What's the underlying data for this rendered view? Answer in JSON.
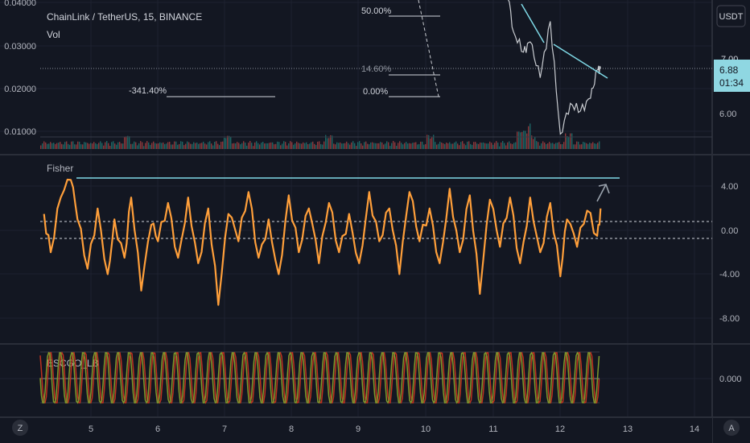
{
  "symbol": {
    "title": "ChainLink / TetherUS, 15, BINANCE",
    "volume_label": "Vol"
  },
  "currency_button": "USDT",
  "price_panel": {
    "left_axis_ticks": [
      "0.04000",
      "0.03000",
      "0.02000",
      "0.01000"
    ],
    "right_axis_ticks": [
      "6.00"
    ],
    "partial_tick": "7.00",
    "last_price": "6.88",
    "countdown": "01:34",
    "fib_levels": [
      {
        "label": "50.00%"
      },
      {
        "label": "14.60%"
      },
      {
        "label": "0.00%"
      },
      {
        "label": "-341.40%"
      }
    ]
  },
  "fisher_panel": {
    "label": "Fisher",
    "right_axis_ticks": [
      "4.00",
      "0.00",
      "-4.00",
      "-8.00"
    ],
    "colors": {
      "line": "#ff9f3a",
      "trend": "#7fd9e6",
      "arrow": "#9aa3ad"
    }
  },
  "escgo_panel": {
    "label": "ESCGO_LB",
    "right_axis_ticks": [
      "0.000"
    ],
    "colors": {
      "green": "#7f9a2c",
      "red": "#c0311f"
    }
  },
  "time_axis": {
    "ticks": [
      "5",
      "6",
      "7",
      "8",
      "9",
      "10",
      "11",
      "12",
      "13",
      "14"
    ],
    "left_button": "Z",
    "right_button": "A"
  },
  "chart_data": {
    "type": "line",
    "series": [
      {
        "indicator": "Fisher",
        "x": [
          4.3,
          4.4,
          4.55,
          4.7,
          4.8,
          4.95,
          5.1,
          5.25,
          5.35,
          5.5,
          5.6,
          5.75,
          5.9,
          6.0,
          6.15,
          6.3,
          6.45,
          6.6,
          6.75,
          6.9,
          7.05,
          7.2,
          7.35,
          7.5,
          7.65,
          7.8,
          7.95,
          8.1,
          8.25,
          8.4,
          8.55,
          8.7,
          8.85,
          9.0,
          9.15,
          9.3,
          9.45,
          9.6,
          9.75,
          9.9,
          10.05,
          10.2,
          10.35,
          10.5,
          10.65,
          10.8,
          10.95,
          11.1,
          11.25,
          11.4,
          11.55,
          11.7,
          11.85,
          12.0,
          12.1,
          12.25,
          12.4,
          12.55,
          12.6
        ],
        "y": [
          1.5,
          -2.0,
          3.0,
          4.6,
          1.0,
          -3.5,
          2.0,
          -4.0,
          1.0,
          -2.5,
          3.0,
          -5.5,
          0.5,
          -1.0,
          2.5,
          -2.5,
          3.0,
          -3.0,
          2.0,
          -6.8,
          1.5,
          -1.0,
          3.5,
          -2.5,
          1.0,
          -4.0,
          3.2,
          -2.0,
          2.0,
          -3.0,
          2.5,
          -2.0,
          1.5,
          -3.0,
          3.5,
          -1.0,
          2.0,
          -4.0,
          3.5,
          -1.0,
          2.0,
          -3.0,
          3.8,
          -2.0,
          3.2,
          -5.8,
          2.8,
          -1.5,
          3.0,
          -3.0,
          3.0,
          -2.0,
          2.5,
          -4.2,
          1.0,
          -1.5,
          1.8,
          -0.5,
          2.0
        ]
      },
      {
        "indicator": "Price (right scale)",
        "x": [
          11.1,
          11.2,
          11.3,
          11.45,
          11.55,
          11.7,
          11.85,
          12.0,
          12.15,
          12.3,
          12.45,
          12.55,
          12.6
        ],
        "y": [
          8.7,
          8.5,
          7.6,
          7.2,
          7.4,
          6.7,
          7.8,
          5.6,
          6.2,
          6.05,
          6.3,
          6.85,
          6.88
        ]
      }
    ],
    "fisher_ylim": [
      -8.5,
      4.8
    ],
    "fisher_reference_lines": [
      0.75,
      -0.75
    ],
    "price_ylim": [
      5.3,
      9.0
    ],
    "xlim": [
      4.3,
      14.6
    ],
    "grid": true
  }
}
